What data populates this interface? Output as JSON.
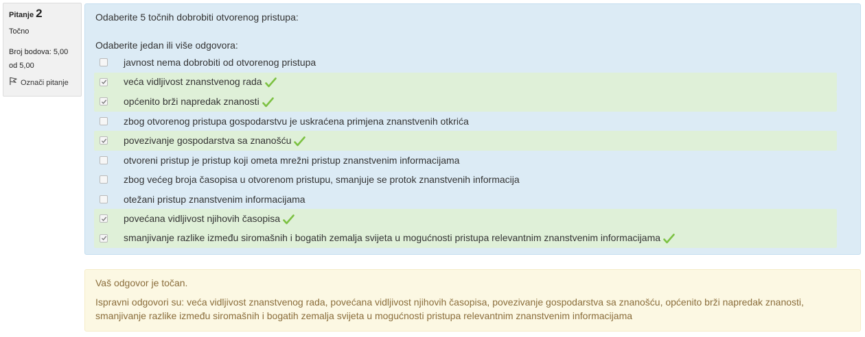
{
  "info": {
    "question_label": "Pitanje",
    "question_number": "2",
    "state": "Točno",
    "grade_line1": "Broj bodova: 5,00",
    "grade_line2": "od 5,00",
    "flag_label": "Označi pitanje",
    "flag_icon": "flag-icon"
  },
  "question": {
    "text": "Odaberite 5 točnih dobrobiti otvorenog pristupa:",
    "prompt": "Odaberite jedan ili više odgovora:",
    "options": [
      {
        "label": "javnost nema dobrobiti od otvorenog pristupa",
        "checked": false,
        "correct": false
      },
      {
        "label": "veća vidljivost znanstvenog rada",
        "checked": true,
        "correct": true
      },
      {
        "label": "općenito brži napredak znanosti",
        "checked": true,
        "correct": true
      },
      {
        "label": "zbog otvorenog pristupa gospodarstvu je uskraćena primjena znanstvenih otkrića",
        "checked": false,
        "correct": false
      },
      {
        "label": "povezivanje gospodarstva sa znanošću",
        "checked": true,
        "correct": true
      },
      {
        "label": "otvoreni pristup je pristup koji ometa mrežni pristup znanstvenim informacijama",
        "checked": false,
        "correct": false
      },
      {
        "label": "zbog većeg broja časopisa u otvorenom pristupu, smanjuje se protok znanstvenih informacija",
        "checked": false,
        "correct": false
      },
      {
        "label": "otežani pristup znanstvenim informacijama",
        "checked": false,
        "correct": false
      },
      {
        "label": "povećana vidljivost njihovih časopisa",
        "checked": true,
        "correct": true
      },
      {
        "label": "smanjivanje razlike između siromašnih i bogatih zemalja svijeta u mogućnosti pristupa relevantnim znanstvenim informacijama",
        "checked": true,
        "correct": true
      }
    ]
  },
  "feedback": {
    "general": "Vaš odgovor je točan.",
    "right_answer": "Ispravni odgovori su: veća vidljivost znanstvenog rada, povećana vidljivost njihovih časopisa, povezivanje gospodarstva sa znanošću, općenito brži napredak znanosti, smanjivanje razlike između siromašnih i bogatih zemalja svijeta u mogućnosti pristupa relevantnim znanstvenim informacijama"
  },
  "colors": {
    "formulation_bg": "#dcebf5",
    "correct_row_bg": "#dff0d8",
    "feedback_bg": "#fcf8e3",
    "feedback_text": "#8a6d3b",
    "tick": "#7cc142"
  }
}
